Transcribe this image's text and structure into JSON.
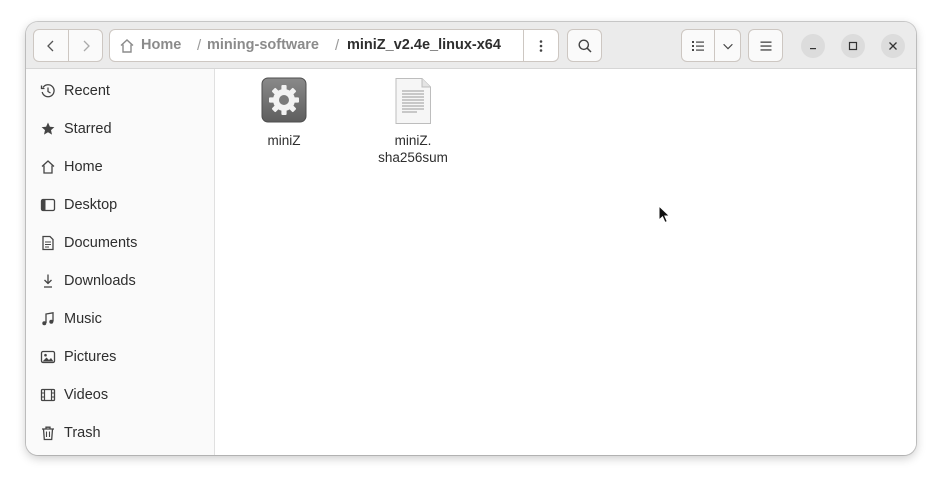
{
  "header": {
    "back_label": "Back",
    "forward_label": "Forward",
    "breadcrumbs": [
      "Home",
      "mining-software",
      "miniZ_v2.4e_linux-x64"
    ],
    "separator": "/"
  },
  "sidebar": {
    "items": [
      {
        "label": "Recent",
        "icon": "clock-icon"
      },
      {
        "label": "Starred",
        "icon": "star-icon"
      },
      {
        "label": "Home",
        "icon": "home-icon"
      },
      {
        "label": "Desktop",
        "icon": "desktop-icon"
      },
      {
        "label": "Documents",
        "icon": "document-icon"
      },
      {
        "label": "Downloads",
        "icon": "download-icon"
      },
      {
        "label": "Music",
        "icon": "music-icon"
      },
      {
        "label": "Pictures",
        "icon": "picture-icon"
      },
      {
        "label": "Videos",
        "icon": "video-icon"
      },
      {
        "label": "Trash",
        "icon": "trash-icon"
      }
    ]
  },
  "files": [
    {
      "name_line1": "miniZ",
      "name_line2": "",
      "icon": "executable-gear-icon"
    },
    {
      "name_line1": "miniZ.",
      "name_line2": "sha256sum",
      "icon": "text-file-icon"
    }
  ],
  "colors": {
    "headerbar": "#ebebeb",
    "sidebar": "#fafafa",
    "content": "#ffffff",
    "text": "#2e2e2e"
  }
}
